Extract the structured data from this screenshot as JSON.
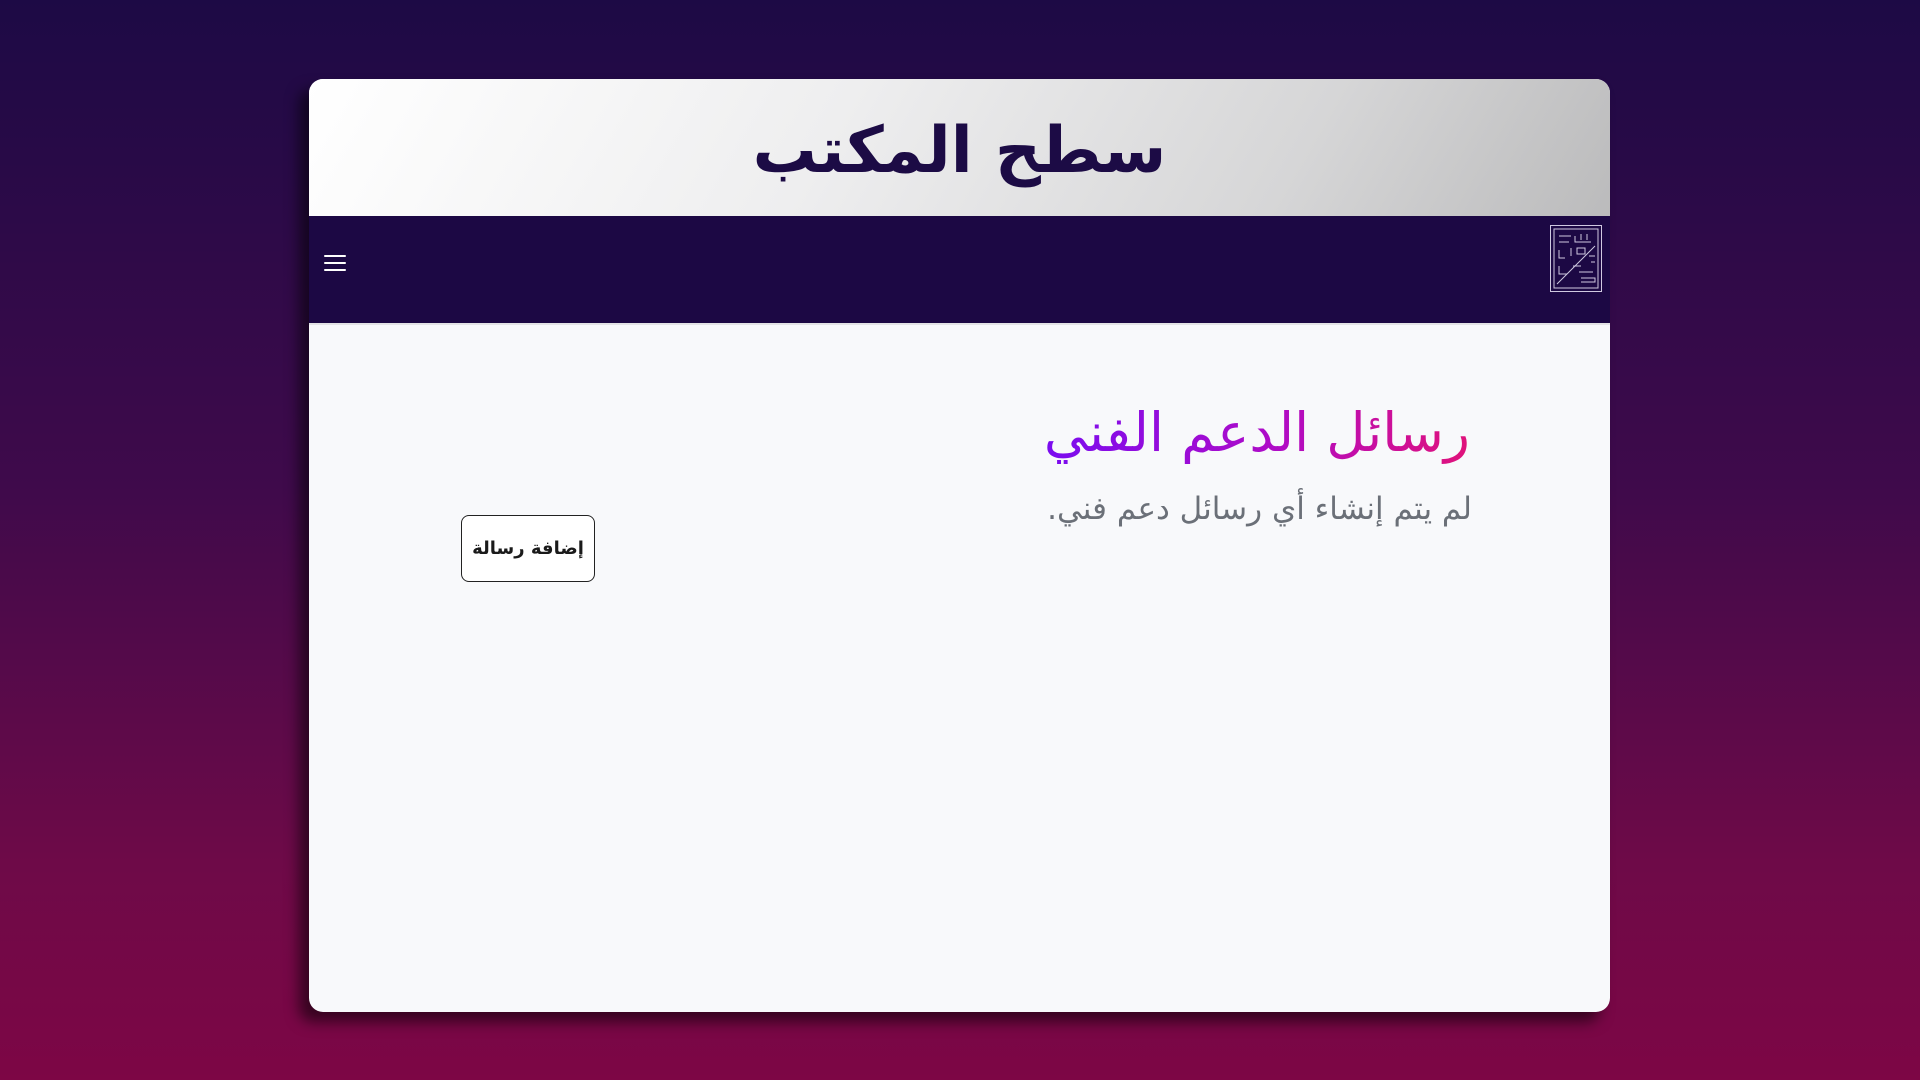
{
  "app": {
    "title": "سطح المكتب"
  },
  "navbar": {
    "menu_icon": "hamburger-menu-icon",
    "logo_icon": "calligraphy-logo-icon",
    "background_color": "#1c0844"
  },
  "main": {
    "heading": "رسائل الدعم الفني",
    "empty_message": "لم يتم إنشاء أي رسائل دعم فني.",
    "add_button_label": "إضافة رسالة",
    "heading_gradient": [
      "#7a0cf0",
      "#e0127a"
    ]
  }
}
